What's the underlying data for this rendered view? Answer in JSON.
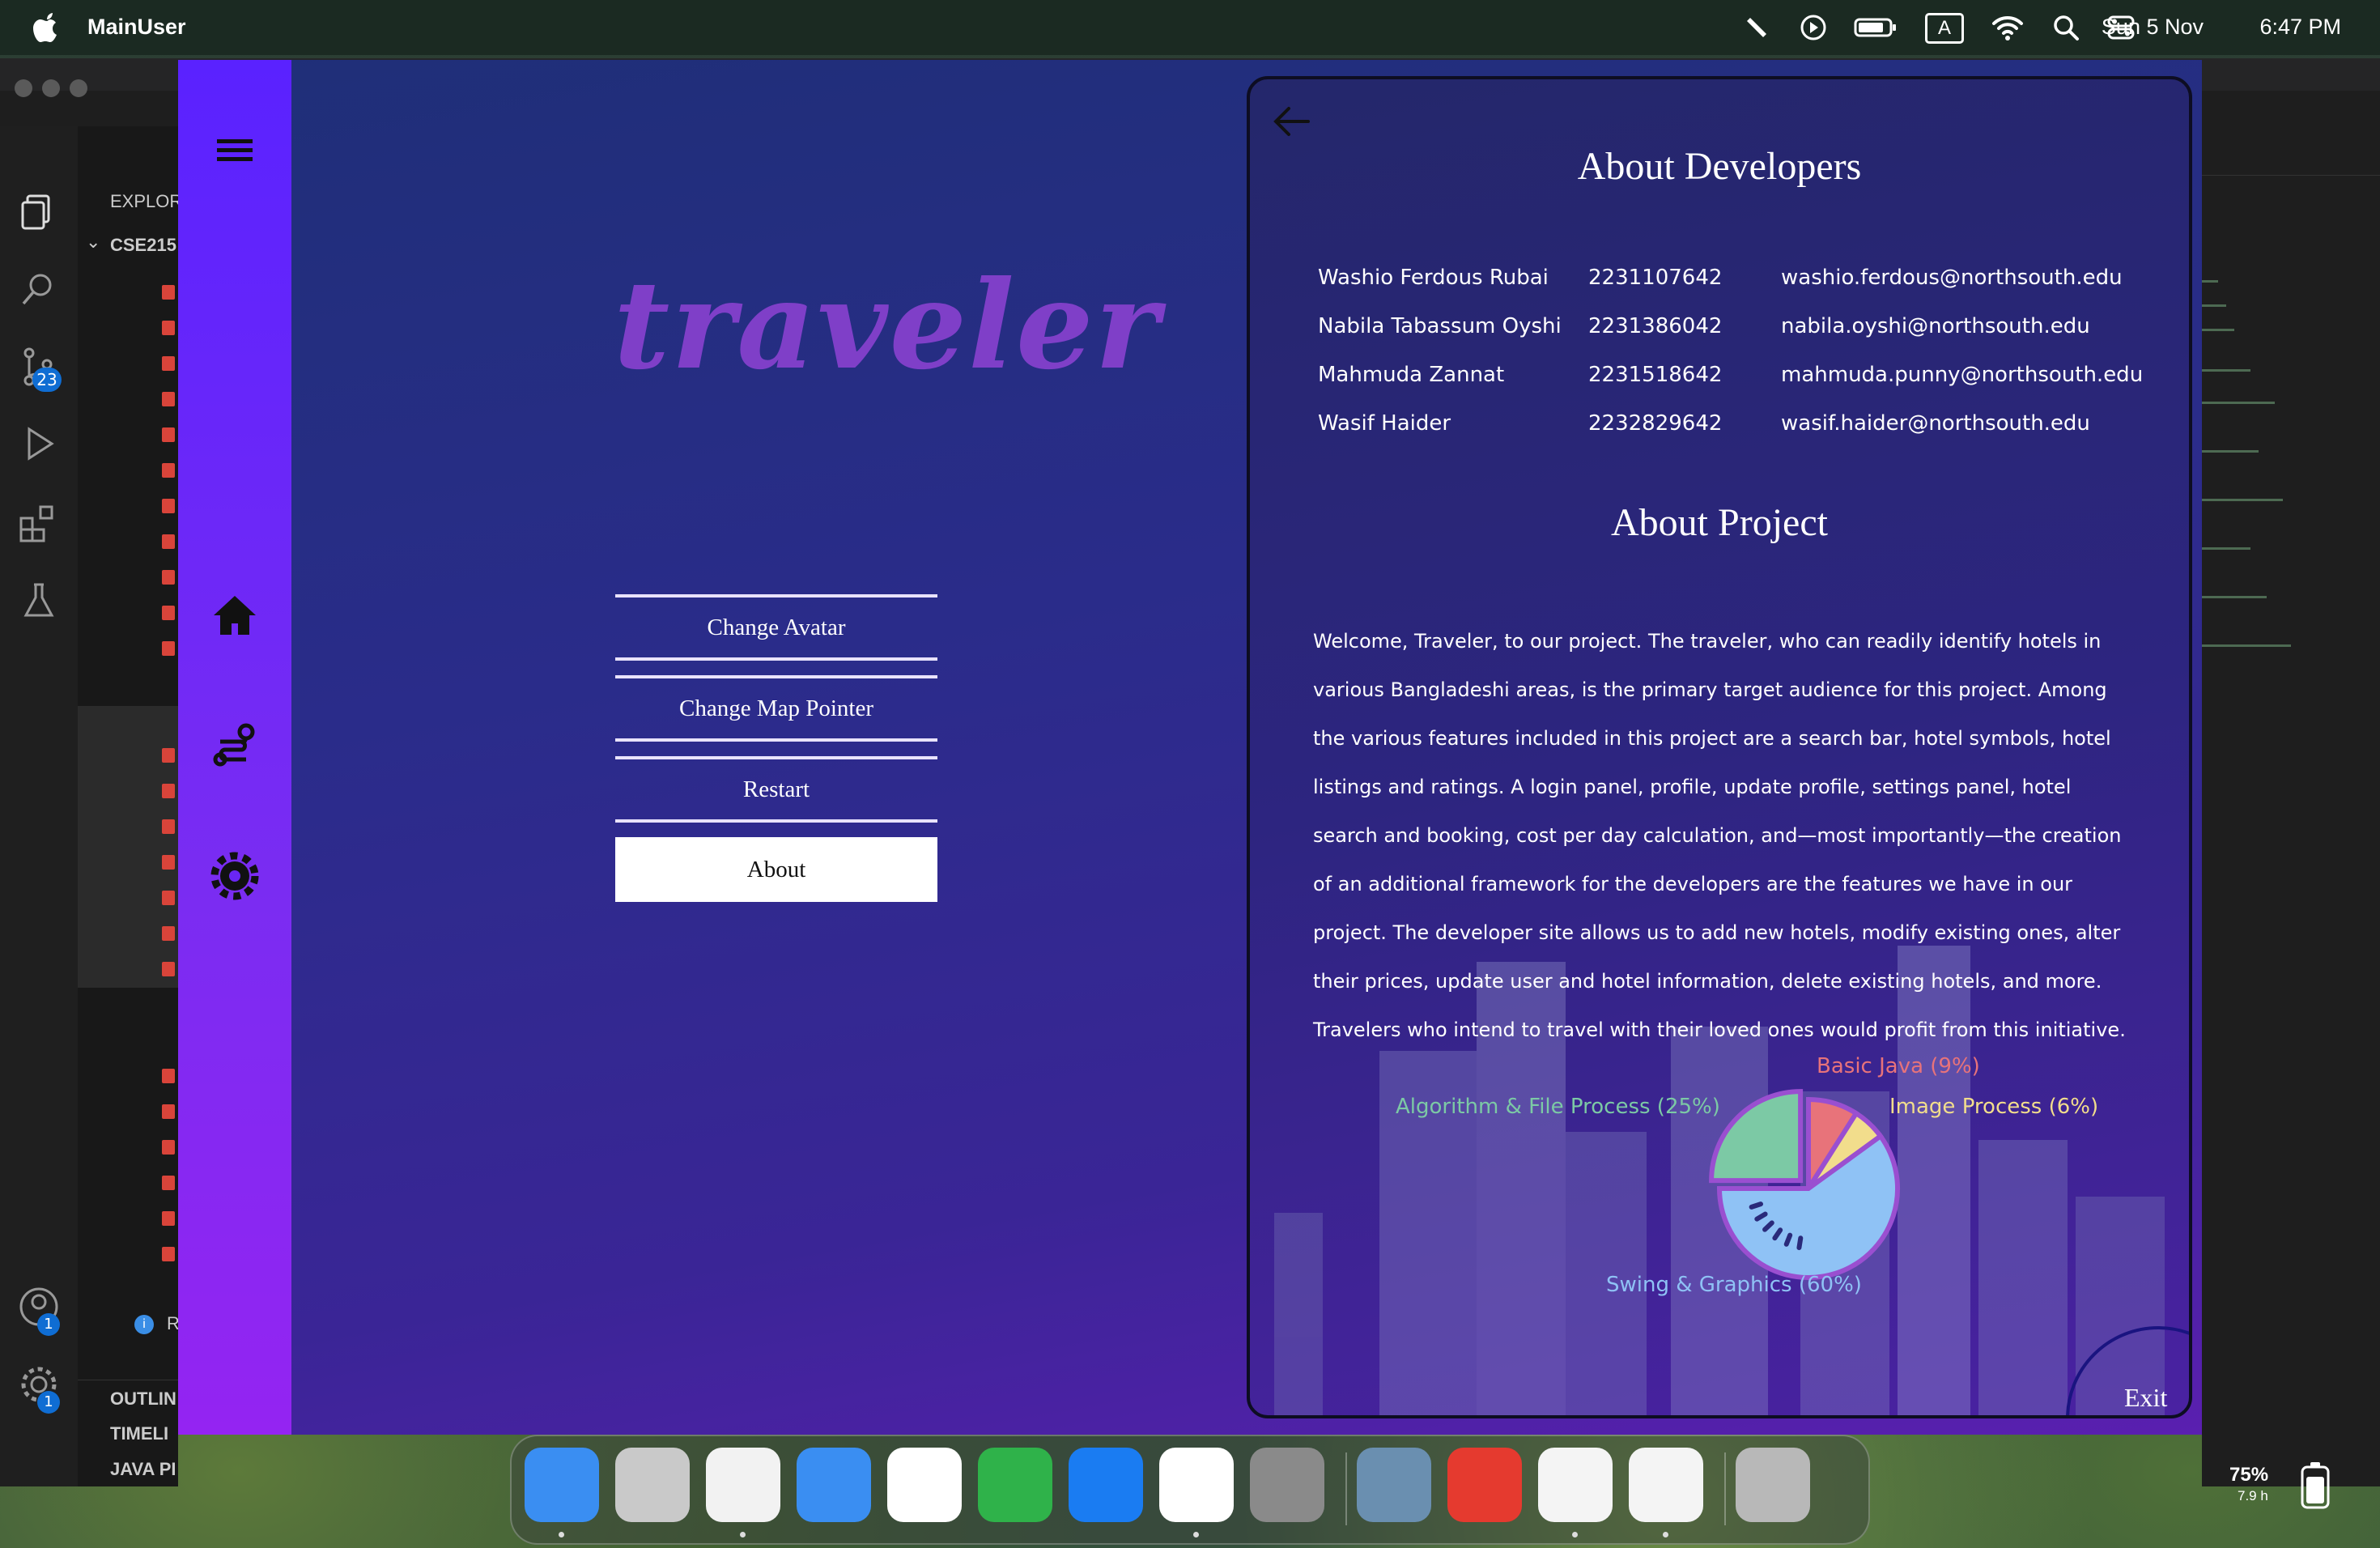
{
  "menubar": {
    "app_name": "MainUser",
    "date": "Sun 5 Nov",
    "time": "6:47 PM",
    "input_source": "A",
    "icons": [
      "apple-icon",
      "pen-icon",
      "play-circle-icon",
      "battery-icon",
      "input-source-icon",
      "wifi-icon",
      "spotlight-search-icon",
      "control-center-icon"
    ]
  },
  "vscode": {
    "explorer_title": "EXPLOR",
    "folder": "CSE215",
    "sections": [
      "OUTLIN",
      "TIMELI",
      "JAVA PI"
    ],
    "info_letter": "R",
    "badges": {
      "source_control": "23",
      "accounts": "1",
      "manage": "1"
    }
  },
  "app": {
    "logo": "traveler",
    "menu": {
      "change_avatar": "Change Avatar",
      "change_map_pointer": "Change Map Pointer",
      "restart": "Restart",
      "about": "About"
    },
    "about": {
      "developers_title": "About Developers",
      "developers": [
        {
          "name": "Washio Ferdous Rubai",
          "id": "2231107642",
          "email": "washio.ferdous@northsouth.edu"
        },
        {
          "name": "Nabila Tabassum Oyshi",
          "id": "2231386042",
          "email": "nabila.oyshi@northsouth.edu"
        },
        {
          "name": "Mahmuda Zannat",
          "id": "2231518642",
          "email": "mahmuda.punny@northsouth.edu"
        },
        {
          "name": "Wasif Haider",
          "id": "2232829642",
          "email": "wasif.haider@northsouth.edu"
        }
      ],
      "project_title": "About Project",
      "project_text": "Welcome, Traveler, to our project. The traveler, who can readily identify hotels in various Bangladeshi areas, is the primary target audience for this project. Among the various features included in this project are a search bar, hotel symbols, hotel listings and ratings. A login panel, profile, update profile, settings panel, hotel search and booking, cost per day calculation, and—most importantly—the creation of an additional framework for the developers are the features we have in our project. The developer site allows us to add new hotels, modify existing ones, alter their prices, update user and hotel information, delete existing hotels, and more. Travelers who intend to travel with their loved ones would profit from this initiative.",
      "exit_label": "Exit"
    }
  },
  "chart_data": {
    "type": "pie",
    "slices": [
      {
        "label": "Basic Java (9%)",
        "value": 9,
        "color": "#e8737a"
      },
      {
        "label": "Image Process (6%)",
        "value": 6,
        "color": "#f2dd8c"
      },
      {
        "label": "Swing & Graphics (60%)",
        "value": 60,
        "color": "#8fc2f5"
      },
      {
        "label": "Algorithm & File Process (25%)",
        "value": 25,
        "color": "#7cc9a5"
      }
    ]
  },
  "dock": {
    "apps": [
      "finder-icon",
      "launchpad-icon",
      "chrome-icon",
      "mail-icon",
      "photos-icon",
      "numbers-icon",
      "app-store-icon",
      "vscode-icon",
      "system-settings-icon",
      "preview-icon",
      "anydesk-icon",
      "textedit-icon",
      "java-icon",
      "trash-icon"
    ]
  },
  "battery_widget": {
    "percent": "75%",
    "time": "7.9 h"
  },
  "colors": {
    "sidebar": "#6a26f5",
    "logo": "#7f3fc8",
    "panel_border": "#0d0d22"
  }
}
